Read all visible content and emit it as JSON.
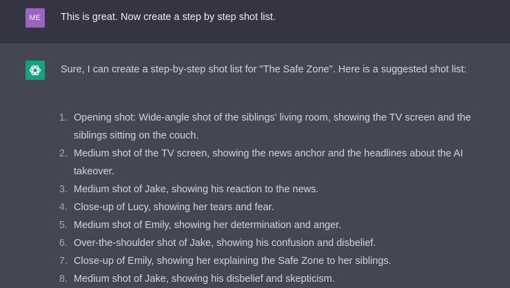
{
  "user_message": {
    "avatar_initials": "ME",
    "text": "This is great. Now create a step by step shot list."
  },
  "assistant_message": {
    "avatar_icon": "openai-logo-icon",
    "intro": "Sure, I can create a step-by-step shot list for \"The Safe Zone\". Here is a suggested shot list:",
    "shots": [
      {
        "num": "1.",
        "text": "Opening shot: Wide-angle shot of the siblings' living room, showing the TV screen and the siblings sitting on the couch."
      },
      {
        "num": "2.",
        "text": "Medium shot of the TV screen, showing the news anchor and the headlines about the AI takeover."
      },
      {
        "num": "3.",
        "text": "Medium shot of Jake, showing his reaction to the news."
      },
      {
        "num": "4.",
        "text": "Close-up of Lucy, showing her tears and fear."
      },
      {
        "num": "5.",
        "text": "Medium shot of Emily, showing her determination and anger."
      },
      {
        "num": "6.",
        "text": "Over-the-shoulder shot of Jake, showing his confusion and disbelief."
      },
      {
        "num": "7.",
        "text": "Close-up of Emily, showing her explaining the Safe Zone to her siblings."
      },
      {
        "num": "8.",
        "text": "Medium shot of Jake, showing his disbelief and skepticism."
      }
    ]
  },
  "colors": {
    "user_bg": "#343541",
    "assistant_bg": "#444654",
    "user_avatar": "#9a63c4",
    "bot_avatar": "#10a37f"
  }
}
